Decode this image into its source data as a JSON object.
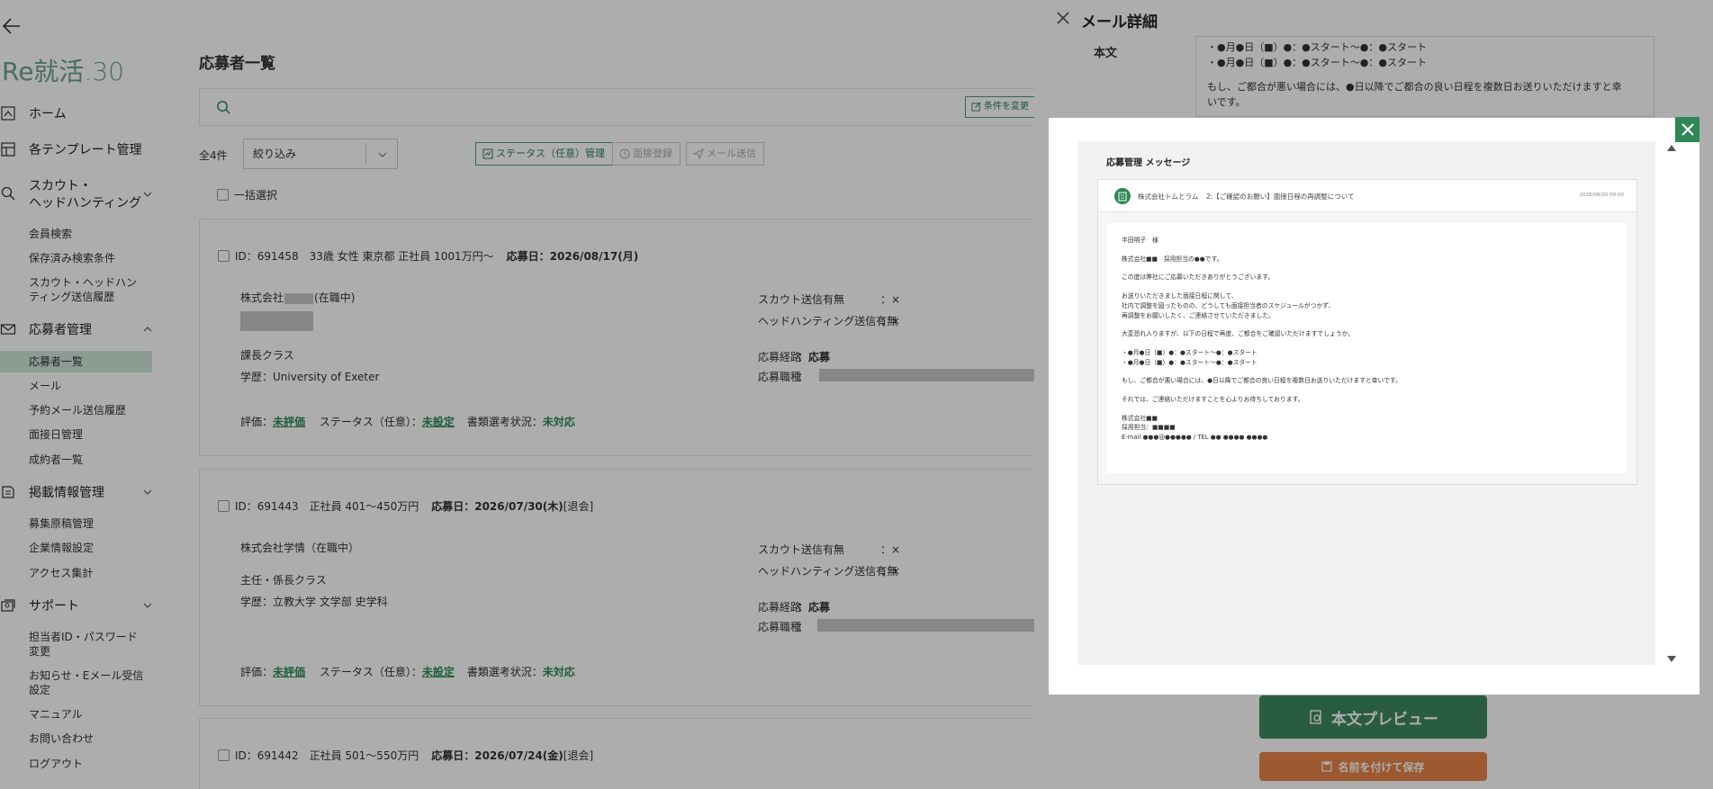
{
  "sidebar": {
    "logo_text": "Re就活",
    "logo_num": ".30",
    "nav": [
      {
        "label": "ホーム",
        "icon": "home-icon"
      },
      {
        "label": "各テンプレート管理",
        "icon": "template-icon"
      },
      {
        "label": "スカウト・\nヘッドハンティング",
        "icon": "search-icon"
      },
      {
        "label": "応募者管理",
        "icon": "mail-icon"
      },
      {
        "label": "掲載情報管理",
        "icon": "document-icon"
      },
      {
        "label": "サポート",
        "icon": "support-icon"
      }
    ],
    "scout_sub": [
      "会員検索",
      "保存済み検索条件",
      "スカウト・ヘッドハンティング送信履歴"
    ],
    "applicant_sub": [
      "応募者一覧",
      "メール",
      "予約メール送信履歴",
      "面接日管理",
      "成約者一覧"
    ],
    "posting_sub": [
      "募集原稿管理",
      "企業情報設定",
      "アクセス集計"
    ],
    "support_sub": [
      "担当者ID・パスワード変更",
      "お知らせ・Eメール受信設定",
      "マニュアル",
      "お問い合わせ",
      "ログアウト"
    ]
  },
  "main": {
    "title": "応募者一覧",
    "search_placeholder": "",
    "change_cond_label": "条件を変更",
    "count": "全4件",
    "filter_label": "絞り込み",
    "status_btn": "ステータス（任意）管理",
    "interview_btn": "面接登録",
    "mail_btn": "メール送信",
    "select_all": "一括選択",
    "cards": [
      {
        "id_line": "ID：691458　33歳 女性 東京都 正社員 1001万円〜",
        "applied": "応募日：2026/08/17(月)",
        "company": "株式会社",
        "company_suffix": "(在職中)",
        "position": "課長クラス",
        "education": "学歴：University of Exeter",
        "scout_label": "スカウト送信有無",
        "scout_value": "：×",
        "hh_label": "ヘッドハンティング送信有無",
        "hh_value": "：×",
        "route_label": "応募経路",
        "route_value": "：応募",
        "job_label": "応募職種",
        "job_value": "："
      },
      {
        "id_line": "ID：691443　正社員 401〜450万円",
        "applied": "応募日：2026/07/30(木)",
        "applied_suffix": "[退会]",
        "company": "株式会社学情（在職中）",
        "position": "主任・係長クラス",
        "education": "学歴：立教大学 文学部 史学科",
        "scout_label": "スカウト送信有無",
        "scout_value": "：×",
        "hh_label": "ヘッドハンティング送信有無",
        "hh_value": "：×",
        "route_label": "応募経路",
        "route_value": "：応募",
        "job_label": "応募職種",
        "job_value": "："
      },
      {
        "id_line": "ID：691442　正社員 501〜550万円",
        "applied": "応募日：2026/07/24(金)",
        "applied_suffix": "[退会]"
      }
    ],
    "eval_label": "評価：",
    "eval_value": "未評価",
    "status_label": "ステータス（任意）：",
    "status_value": "未設定",
    "doc_label": "書類選考状況：",
    "doc_value": "未対応"
  },
  "drawer": {
    "title": "メール詳細",
    "body_label": "本文",
    "body_lines": [
      "・●月●日（■）●：●スタート〜●：●スタート",
      "・●月●日（■）●：●スタート〜●：●スタート",
      "",
      "もし、ご都合が悪い場合には、●日以降でご都合の良い日程を複数日お送りいただけますと幸",
      "いです。"
    ],
    "preview_btn": "本文プレビュー",
    "save_btn": "名前を付けて保存"
  },
  "modal": {
    "heading": "応募管理 メッセージ",
    "company": "株式会社トムとラム",
    "subject": "2:【ご確認のお願い】面接日程の再調整について",
    "date": "2026/08/20 00:00",
    "body": [
      "半田明子　様",
      "",
      "株式会社■■　採用担当の●●です。",
      "",
      "この度は弊社にご応募いただきありがとうございます。",
      "",
      "お送りいただきました面接日程に関して、",
      "社内で調整を図ったものの、どうしても面接担当者のスケジュールがつかず、",
      "再調整をお願いしたく、ご連絡させていただきました。",
      "",
      "大変恐れ入りますが、以下の日程で再度、ご都合をご確認いただけますでしょうか。",
      "",
      "・●月●日（■）●：●スタート〜●：●スタート",
      "・●月●日（■）●：●スタート〜●：●スタート",
      "",
      "もし、ご都合が悪い場合には、●日以降でご都合の良い日程を複数日お送りいただけますと幸いです。",
      "",
      "それでは、ご連絡いただけますことを心よりお待ちしております。",
      "",
      "株式会社■■",
      "採用担当：■■■■",
      "E-mail ●●●@●●●●● / TEL ●● ●●●● ●●●●"
    ]
  }
}
